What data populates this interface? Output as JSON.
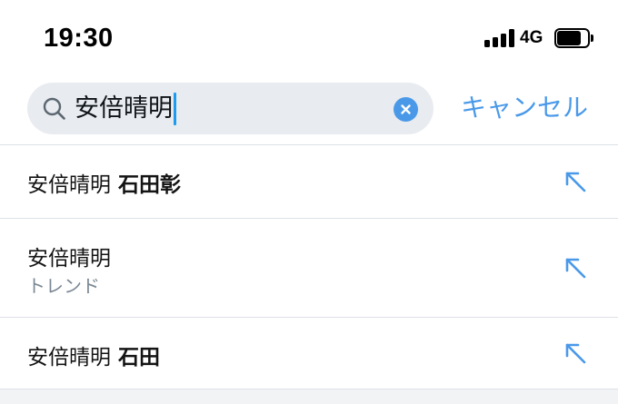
{
  "status_bar": {
    "time": "19:30",
    "network": "4G",
    "signal_bars": 4,
    "battery_level": 0.78,
    "icons": [
      "signal-icon",
      "battery-icon"
    ]
  },
  "search": {
    "value": "安倍晴明",
    "icon": "search-icon",
    "clear_icon": "clear-icon",
    "cancel_label": "キャンセル"
  },
  "suggestions": [
    {
      "prefix": "安倍晴明",
      "completion": "石田彰",
      "arrow_icon": "arrow-up-left-icon"
    },
    {
      "title": "安倍晴明",
      "subtitle": "トレンド",
      "arrow_icon": "arrow-up-left-icon"
    },
    {
      "prefix": "安倍晴明",
      "completion": "石田",
      "arrow_icon": "arrow-up-left-icon"
    }
  ],
  "colors": {
    "accent": "#4a99e9",
    "search_bg": "#e8ebef",
    "divider": "#dde1e6",
    "subtitle": "#7a8894"
  }
}
